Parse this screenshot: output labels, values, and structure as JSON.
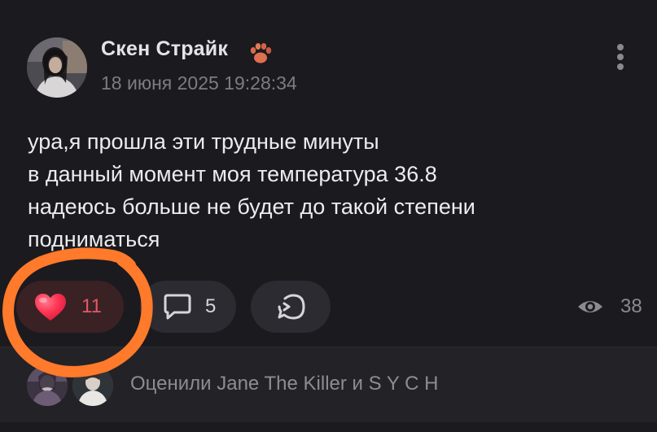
{
  "post": {
    "author": "Скен Страйк",
    "author_badge_icon": "paw-icon",
    "date": "18 июня 2025 19:28:34",
    "text": "ура,я прошла эти трудные минуты\nв данный момент моя температура 36.8\nнадеюсь больше не будет до такой степени\nподниматься"
  },
  "actions": {
    "likes": "11",
    "comments": "5",
    "views": "38",
    "like_icon": "heart-icon",
    "comment_icon": "speech-bubble-icon",
    "repost_icon": "repost-icon",
    "views_icon": "eye-icon"
  },
  "likers": {
    "text": "Оценили Jane The Killer и S Y C H"
  },
  "colors": {
    "background": "#1b1a1f",
    "like_pill": "#3a2124",
    "like_count": "#e45865",
    "heart": "#ff3b57",
    "annotation": "#ff7a2a"
  }
}
